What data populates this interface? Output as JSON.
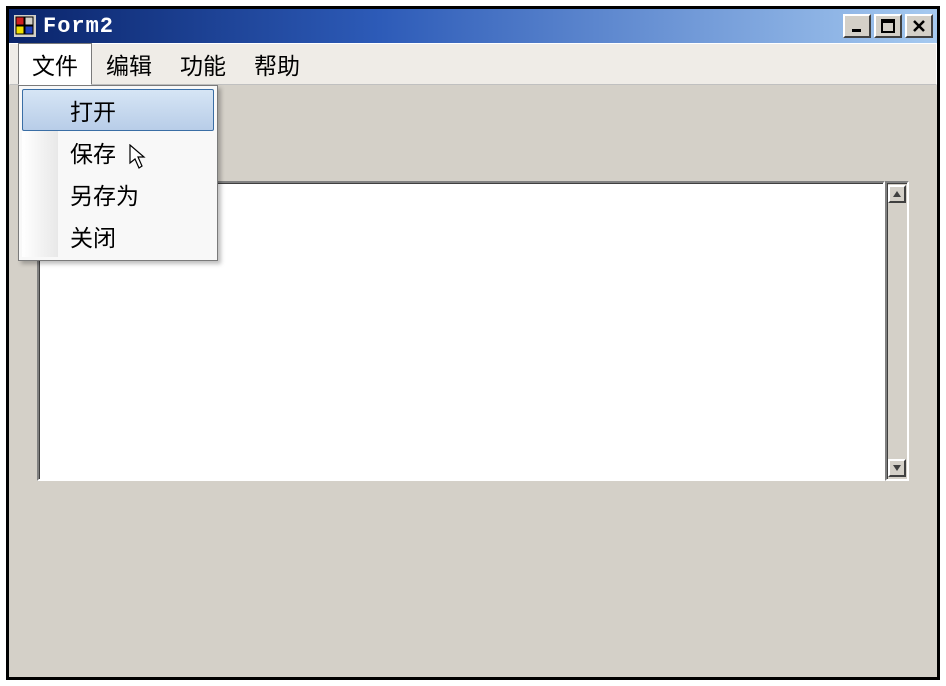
{
  "window": {
    "title": "Form2"
  },
  "menu": {
    "items": [
      {
        "label": "文件",
        "active": true
      },
      {
        "label": "编辑",
        "active": false
      },
      {
        "label": "功能",
        "active": false
      },
      {
        "label": "帮助",
        "active": false
      }
    ]
  },
  "file_dropdown": {
    "items": [
      {
        "label": "打开",
        "hovered": true
      },
      {
        "label": "保存",
        "hovered": false
      },
      {
        "label": "另存为",
        "hovered": false
      },
      {
        "label": "关闭",
        "hovered": false
      }
    ]
  },
  "textbox": {
    "value": ""
  }
}
